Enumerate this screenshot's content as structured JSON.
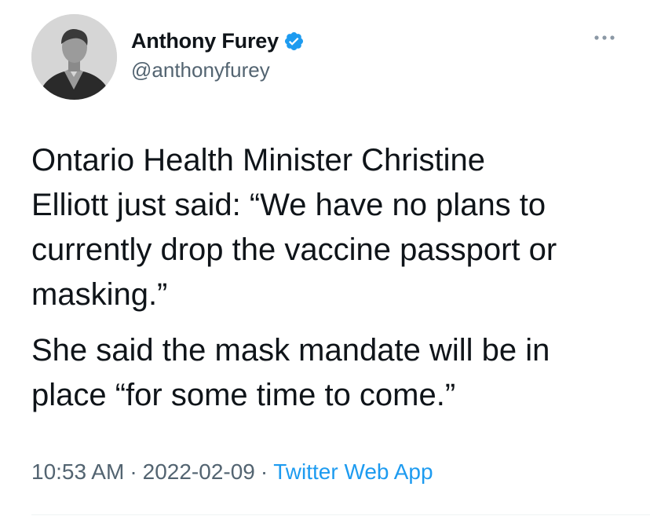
{
  "author": {
    "display_name": "Anthony Furey",
    "handle": "@anthonyfurey",
    "verified": true,
    "avatar_icon": "profile-photo"
  },
  "tweet": {
    "paragraphs": [
      "Ontario Health Minister Christine\nElliott just said: “We have no plans to\ncurrently drop the vaccine passport or\nmasking.”",
      "She said the mask mandate will be in\nplace “for some time to come.”"
    ]
  },
  "meta": {
    "time": "10:53 AM",
    "separator": "·",
    "date": "2022-02-09",
    "source": "Twitter Web App"
  },
  "icons": {
    "more": "more-options-icon",
    "verified": "verified-badge-icon"
  },
  "colors": {
    "primary_text": "#0f1419",
    "secondary_text": "#536471",
    "link": "#1d9bf0",
    "verified_badge": "#1d9bf0"
  }
}
